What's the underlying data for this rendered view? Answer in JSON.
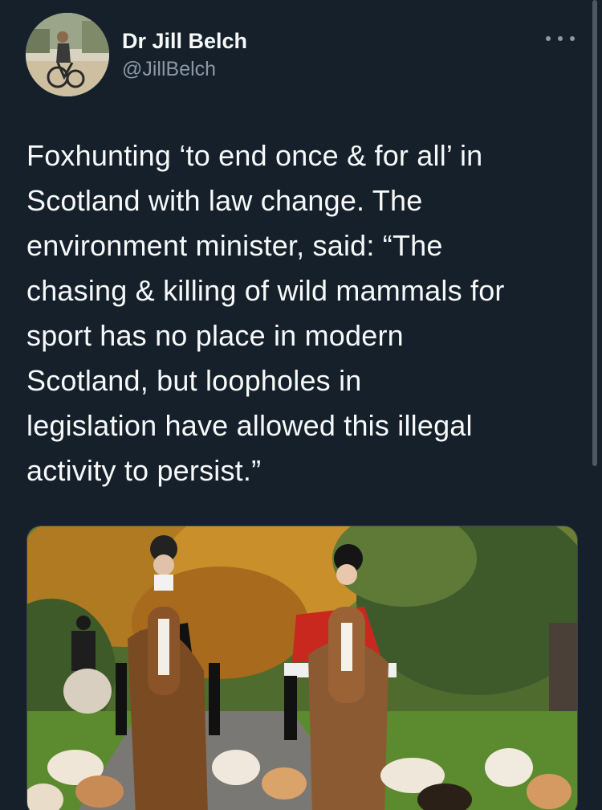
{
  "author": {
    "display_name": "Dr Jill Belch",
    "handle": "@JillBelch",
    "avatar_icon": "profile-photo"
  },
  "menu": {
    "icon": "more-horizontal-icon"
  },
  "tweet": {
    "lines": [
      "Foxhunting ‘to end once & for all’ in",
      "Scotland with law change. The",
      "environment minister, said: “The",
      "chasing & killing of wild mammals for",
      "sport has no place in modern",
      "Scotland, but loopholes in",
      "legislation have allowed this illegal",
      "activity to persist.”"
    ]
  },
  "colors": {
    "background": "#15202b",
    "text": "#f7f9f9",
    "secondary": "#8b98a5"
  }
}
